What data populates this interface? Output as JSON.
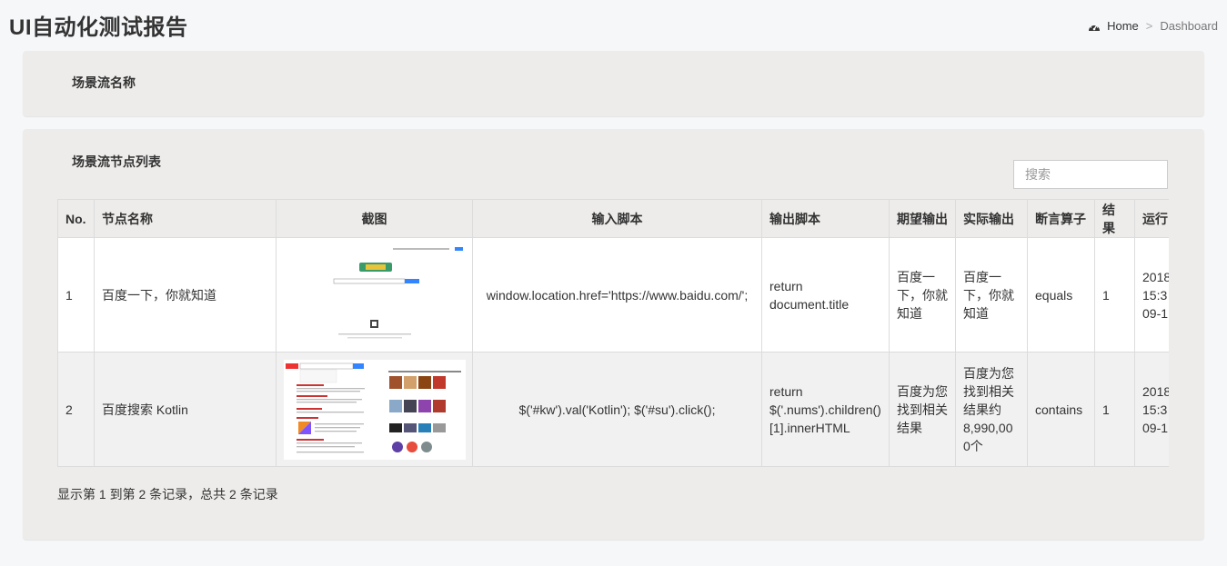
{
  "header": {
    "title": "UI自动化测试报告"
  },
  "breadcrumb": {
    "home": "Home",
    "separator": ">",
    "current": "Dashboard"
  },
  "scenario": {
    "name_label": "场景流名称"
  },
  "nodes": {
    "title": "场景流节点列表",
    "search_placeholder": "搜索",
    "columns": [
      "No.",
      "节点名称",
      "截图",
      "输入脚本",
      "输出脚本",
      "期望输出",
      "实际输出",
      "断言算子",
      "结果",
      "运行"
    ],
    "rows": [
      {
        "no": "1",
        "name": "百度一下，你就知道",
        "input_script": "window.location.href='https://www.baidu.com/';",
        "output_script": "return document.title",
        "expected": "百度一下，你就知道",
        "actual": "百度一下，你就知道",
        "operator": "equals",
        "result": "1",
        "run_time": "2018 15:3 09-1"
      },
      {
        "no": "2",
        "name": "百度搜索 Kotlin",
        "input_script": "$('#kw').val('Kotlin'); $('#su').click();",
        "output_script": "return $('.nums').children()[1].innerHTML",
        "expected": "百度为您找到相关结果",
        "actual": "百度为您找到相关结果约8,990,000个",
        "operator": "contains",
        "result": "1",
        "run_time": "2018 15:3 09-1"
      }
    ],
    "footer": "显示第 1 到第 2 条记录，总共 2 条记录"
  },
  "colors": {
    "box_bg": "#edecea",
    "page_bg": "#f6f7f9",
    "accent_blue": "#3385ff"
  }
}
